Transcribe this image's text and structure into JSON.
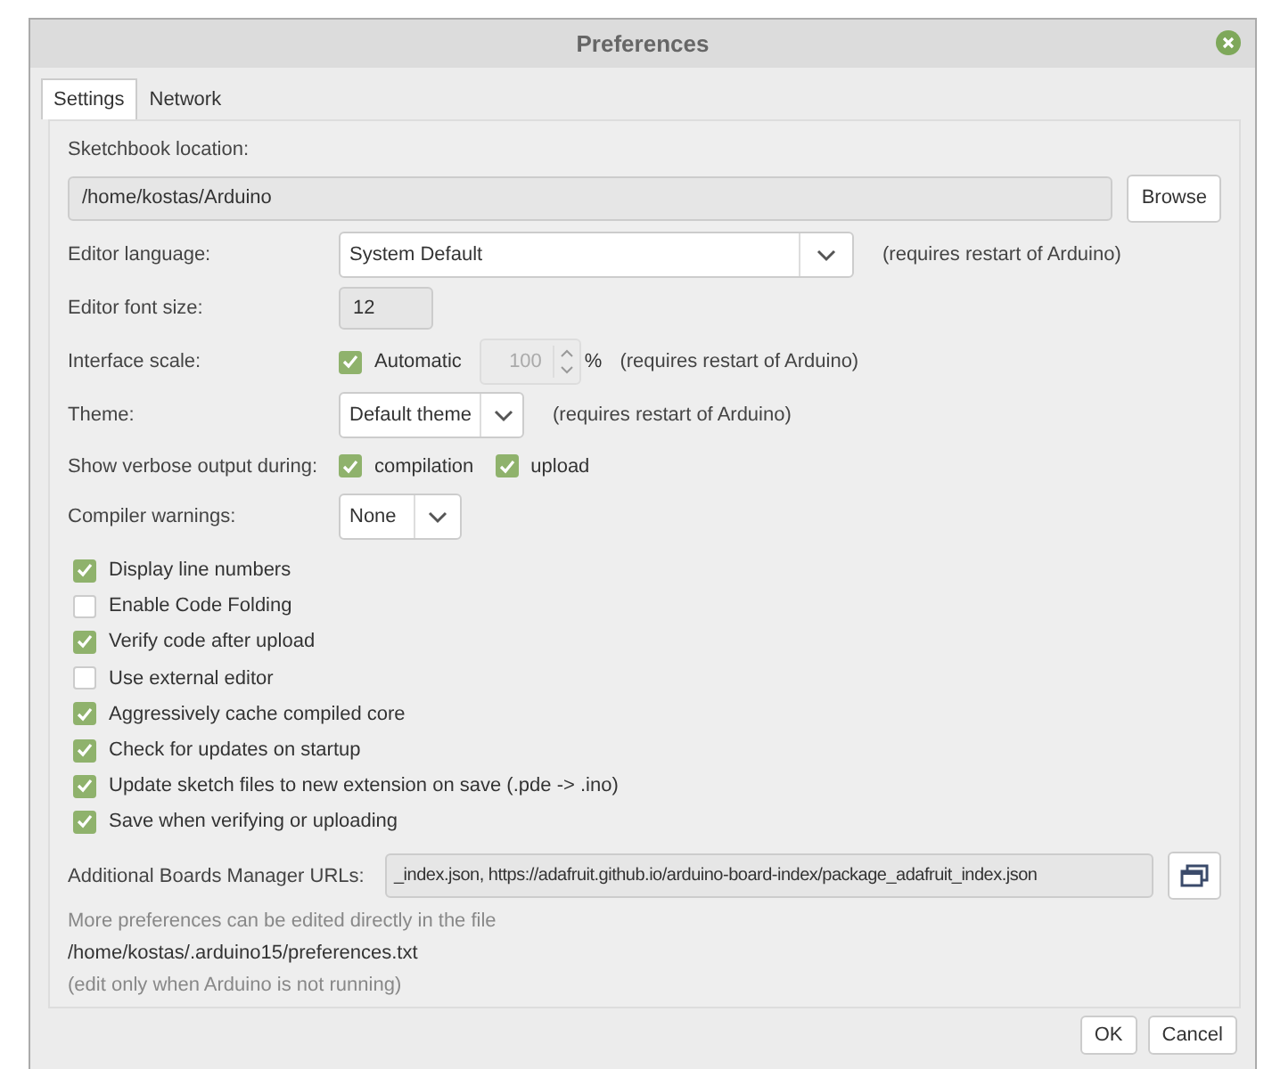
{
  "window": {
    "title": "Preferences"
  },
  "tabs": [
    {
      "label": "Settings",
      "selected": true
    },
    {
      "label": "Network",
      "selected": false
    }
  ],
  "sketchbook": {
    "label": "Sketchbook location:",
    "value": "/home/kostas/Arduino",
    "button": "Browse"
  },
  "editor_language": {
    "label": "Editor language:",
    "value": "System Default",
    "note": "(requires restart of Arduino)"
  },
  "editor_font_size": {
    "label": "Editor font size:",
    "value": "12"
  },
  "interface_scale": {
    "label": "Interface scale:",
    "automatic": {
      "label": "Automatic",
      "checked": true
    },
    "value": "100",
    "unit": "%",
    "disabled": true,
    "note": "(requires restart of Arduino)"
  },
  "theme": {
    "label": "Theme:",
    "value": "Default theme",
    "note": "(requires restart of Arduino)"
  },
  "verbose": {
    "label": "Show verbose output during:",
    "options": [
      {
        "label": "compilation",
        "checked": true
      },
      {
        "label": "upload",
        "checked": true
      }
    ]
  },
  "compiler_warnings": {
    "label": "Compiler warnings:",
    "value": "None"
  },
  "options": [
    {
      "label": "Display line numbers",
      "checked": true
    },
    {
      "label": "Enable Code Folding",
      "checked": false
    },
    {
      "label": "Verify code after upload",
      "checked": true
    },
    {
      "label": "Use external editor",
      "checked": false
    },
    {
      "label": "Aggressively cache compiled core",
      "checked": true
    },
    {
      "label": "Check for updates on startup",
      "checked": true
    },
    {
      "label": "Update sketch files to new extension on save (.pde -> .ino)",
      "checked": true
    },
    {
      "label": "Save when verifying or uploading",
      "checked": true
    }
  ],
  "boards_urls": {
    "label": "Additional Boards Manager URLs:",
    "value": "_index.json, https://adafruit.github.io/arduino-board-index/package_adafruit_index.json"
  },
  "footer_notes": [
    {
      "text": "More preferences can be edited directly in the file",
      "muted": true
    },
    {
      "text": "/home/kostas/.arduino15/preferences.txt",
      "muted": false
    },
    {
      "text": "(edit only when Arduino is not running)",
      "muted": true
    }
  ],
  "buttons": [
    "OK",
    "Cancel"
  ]
}
